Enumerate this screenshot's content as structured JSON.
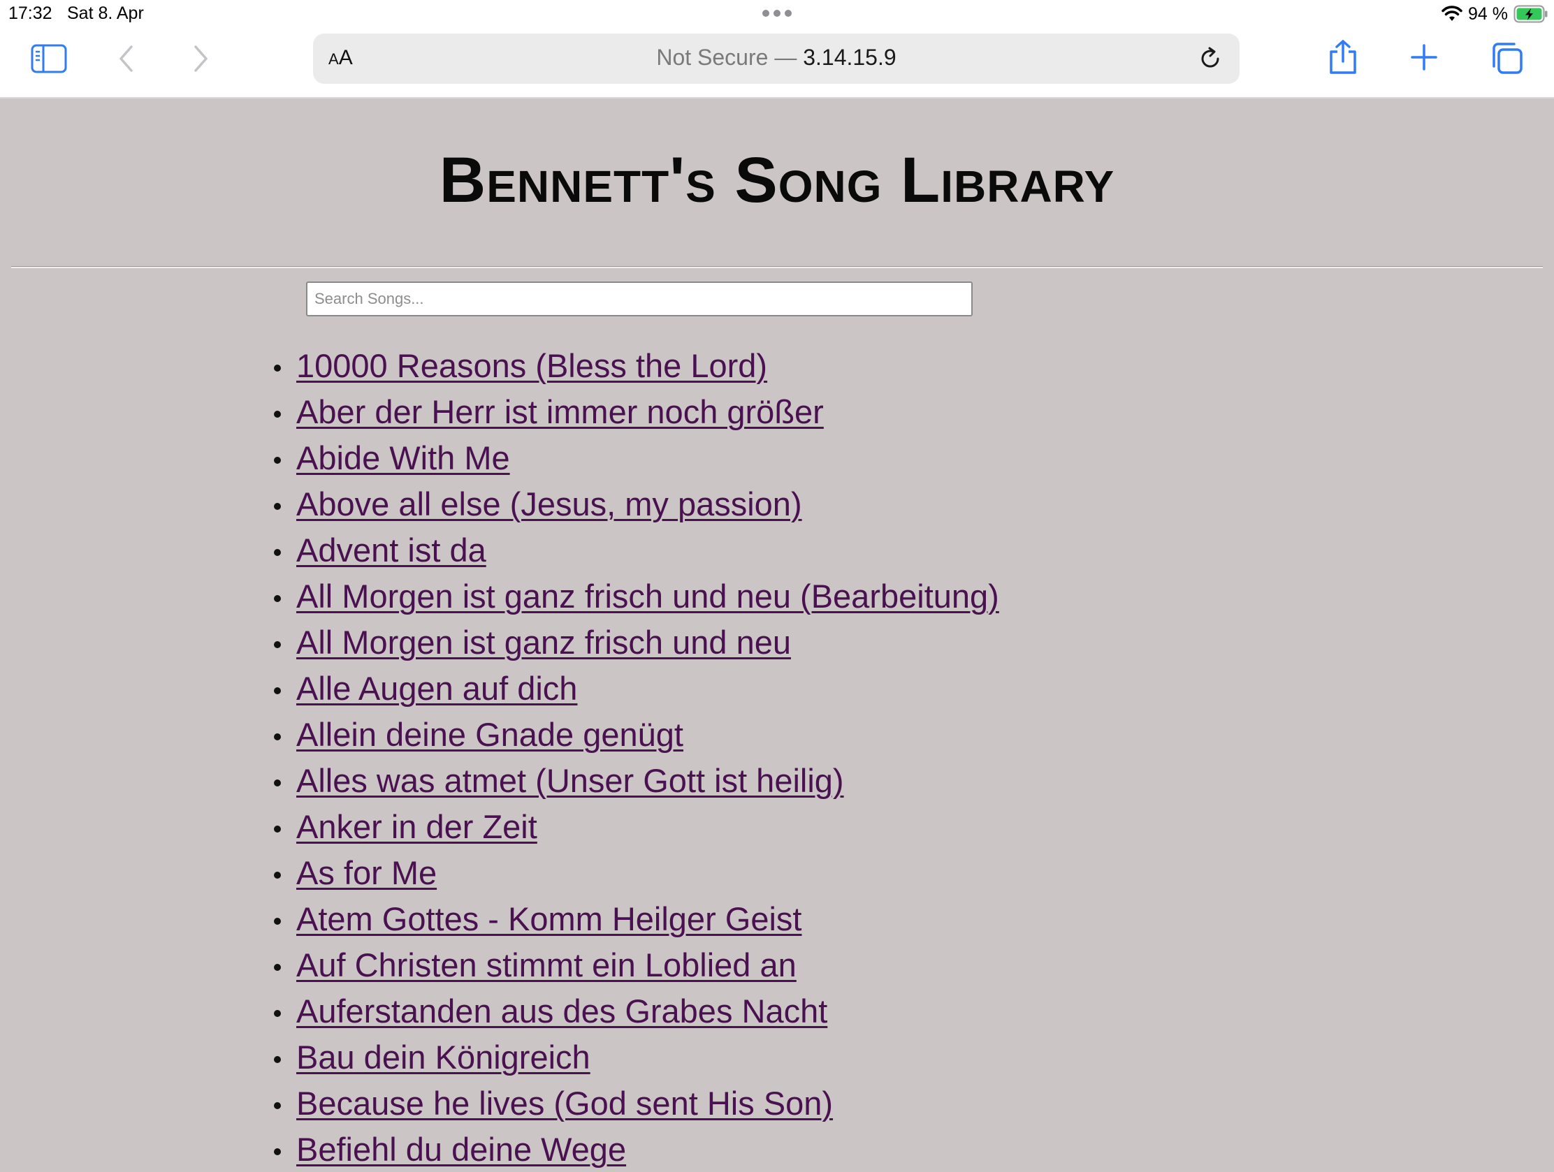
{
  "status_bar": {
    "time": "17:32",
    "date": "Sat 8. Apr",
    "battery": "94 %",
    "battery_color": "#34c759"
  },
  "toolbar": {
    "accent_color": "#2f7cf6",
    "aa_small": "A",
    "aa_large": "A",
    "url_security": "Not Secure —",
    "url_host": "3.14.15.9"
  },
  "page": {
    "title": "Bennett's Song Library",
    "search_placeholder": "Search Songs...",
    "link_color": "#4a1150",
    "background_color": "#cbc6c5",
    "songs": [
      "10000 Reasons (Bless the Lord)",
      "Aber der Herr ist immer noch größer",
      "Abide With Me",
      "Above all else (Jesus, my passion)",
      "Advent ist da",
      "All Morgen ist ganz frisch und neu (Bearbeitung)",
      "All Morgen ist ganz frisch und neu",
      "Alle Augen auf dich",
      "Allein deine Gnade genügt",
      "Alles was atmet (Unser Gott ist heilig)",
      "Anker in der Zeit",
      "As for Me",
      "Atem Gottes - Komm Heilger Geist",
      "Auf Christen stimmt ein Loblied an",
      "Auferstanden aus des Grabes Nacht",
      "Bau dein Königreich",
      "Because he lives (God sent His Son)",
      "Befiehl du deine Wege"
    ]
  }
}
